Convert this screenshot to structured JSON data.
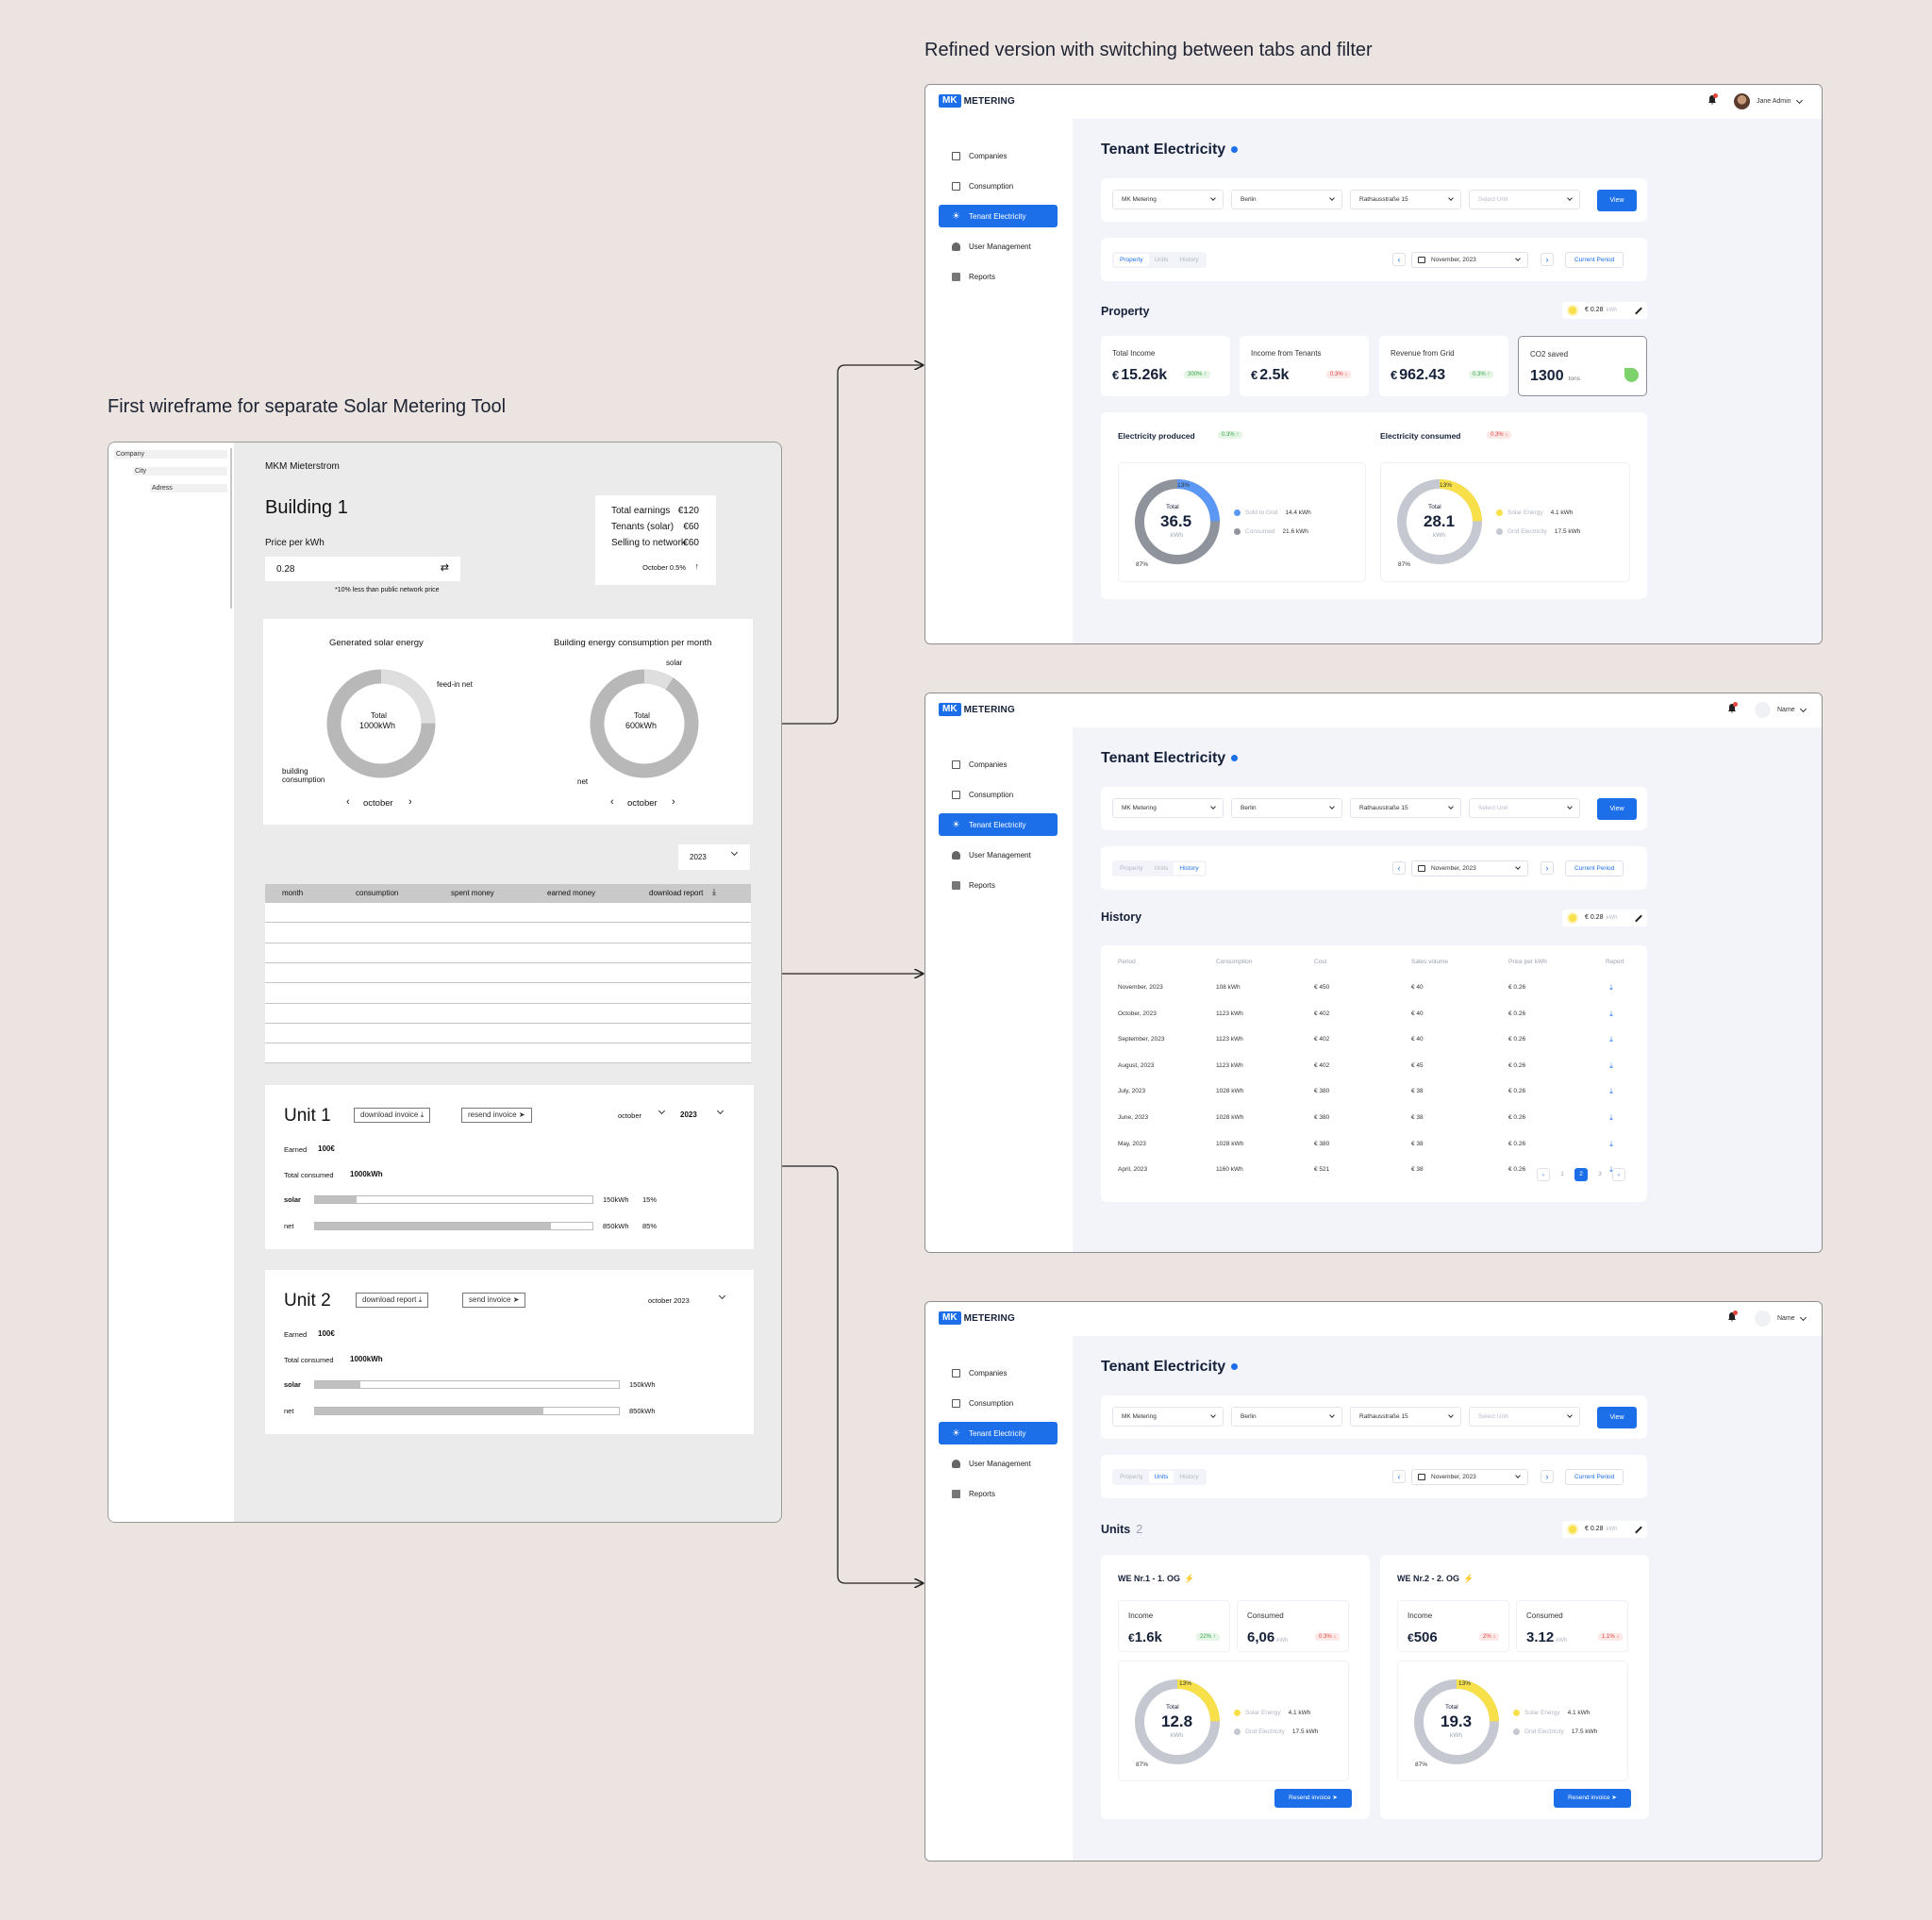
{
  "captions": {
    "refined": "Refined version with  switching between tabs and filter",
    "first": "First wireframe for separate Solar Metering Tool"
  },
  "wireframe": {
    "tree": [
      "Company",
      "City",
      "Adress"
    ],
    "header": "MKM Mieterstrom",
    "building": "Building 1",
    "price_label": "Price per kWh",
    "price_value": "0.28",
    "price_note": "*10% less than public network price",
    "summary": [
      {
        "label": "Total earnings",
        "value": "€120"
      },
      {
        "label": "Tenants (solar)",
        "value": "€60"
      },
      {
        "label": "Selling to network",
        "value": "€60"
      }
    ],
    "summary_foot": "October  0.5%",
    "chart1": {
      "title": "Generated solar energy",
      "total_label": "Total",
      "total": "1000kWh",
      "label_a": "feed-in net",
      "label_b": "building consumption",
      "month": "october"
    },
    "chart2": {
      "title": "Building energy consumption per month",
      "total_label": "Total",
      "total": "600kWh",
      "label_a": "solar",
      "label_b": "net",
      "month": "october"
    },
    "year_select": "2023",
    "table_headers": [
      "month",
      "consumption",
      "spent money",
      "earned money",
      "download report"
    ],
    "unit1": {
      "title": "Unit 1",
      "btn1": "download invoice",
      "btn2": "resend invoice",
      "month": "october",
      "year": "2023",
      "earned_label": "Earned",
      "earned": "100€",
      "total_label": "Total consumed",
      "total": "1000kWh",
      "rows": [
        {
          "name": "solar",
          "value": "150kWh",
          "pct": "15%",
          "fill": 0.15
        },
        {
          "name": "net",
          "value": "850kWh",
          "pct": "85%",
          "fill": 0.85
        }
      ]
    },
    "unit2": {
      "title": "Unit 2",
      "btn1": "download report",
      "btn2": "send invoice",
      "period": "october 2023",
      "earned_label": "Earned",
      "earned": "100€",
      "total_label": "Total consumed",
      "total": "1000kWh",
      "rows": [
        {
          "name": "solar",
          "value": "150kWh",
          "fill": 0.15
        },
        {
          "name": "net",
          "value": "850kWh",
          "fill": 0.75
        }
      ]
    }
  },
  "app": {
    "logo_mk": "MK",
    "logo_text": "METERING",
    "user1": "Jane Admin",
    "user2": "Name",
    "nav": [
      "Companies",
      "Consumption",
      "Tenant Electricity",
      "User Management",
      "Reports"
    ],
    "title": "Tenant Electricity",
    "filters": [
      "MK Metering",
      "Berlin",
      "Rathausstraße 15",
      "Select Unit"
    ],
    "view": "View",
    "tabs": [
      "Property",
      "Units",
      "History"
    ],
    "month": "November, 2023",
    "current": "Current Period",
    "price": "€ 0.28",
    "price_unit": "kWh",
    "colors": {
      "accent": "#1c6fe8",
      "blue": "#5b98f5",
      "gray": "#8f939b",
      "yellow": "#f7e04a",
      "lightgray": "#c5c8d0",
      "green": "#7cd36b"
    }
  },
  "property": {
    "section": "Property",
    "kpis": [
      {
        "label": "Total Income",
        "cur": "€",
        "value": "15.26k",
        "tag": "300% ↑",
        "dir": "up"
      },
      {
        "label": "Income from Tenants",
        "cur": "€",
        "value": "2.5k",
        "tag": "0.3% ↓",
        "dir": "down"
      },
      {
        "label": "Revenue from Grid",
        "cur": "€",
        "value": "962.43",
        "tag": "0.3% ↑",
        "dir": "up"
      },
      {
        "label": "CO2 saved",
        "cur": "",
        "value": "1300",
        "unit": "tons"
      }
    ],
    "produced": {
      "title": "Electricity produced",
      "tag": "0.3% ↑",
      "total_label": "Total",
      "total": "36.5",
      "unit": "kWh",
      "pct_small": "13%",
      "pct_big": "87%",
      "legend": [
        {
          "label": "Sold to Grid",
          "value": "14.4 kWh"
        },
        {
          "label": "Consumed",
          "value": "21.6 kWh"
        }
      ],
      "share": 0.13
    },
    "consumed": {
      "title": "Electricity consumed",
      "tag": "0.3% ↓",
      "total_label": "Total",
      "total": "28.1",
      "unit": "kWh",
      "pct_small": "13%",
      "pct_big": "87%",
      "legend": [
        {
          "label": "Solar Energy",
          "value": "4.1 kWh"
        },
        {
          "label": "Grid Electricity",
          "value": "17.5 kWh"
        }
      ],
      "share": 0.13
    }
  },
  "history": {
    "section": "History",
    "headers": [
      "Period",
      "Consumption",
      "Cost",
      "Sales volume",
      "Price per kWh",
      "Report"
    ],
    "rows": [
      [
        "November, 2023",
        "108 kWh",
        "€ 450",
        "€ 40",
        "€ 0.26"
      ],
      [
        "October, 2023",
        "1123 kWh",
        "€ 402",
        "€ 40",
        "€ 0.26"
      ],
      [
        "September, 2023",
        "1123 kWh",
        "€ 402",
        "€ 40",
        "€ 0.26"
      ],
      [
        "August, 2023",
        "1123 kWh",
        "€ 402",
        "€ 45",
        "€ 0.26"
      ],
      [
        "July, 2023",
        "1028 kWh",
        "€ 380",
        "€ 38",
        "€ 0.26"
      ],
      [
        "June, 2023",
        "1028 kWh",
        "€ 380",
        "€ 38",
        "€ 0.26"
      ],
      [
        "May, 2023",
        "1028 kWh",
        "€ 380",
        "€ 38",
        "€ 0.26"
      ],
      [
        "April, 2023",
        "1160 kWh",
        "€ 521",
        "€ 38",
        "€ 0.26"
      ]
    ],
    "pages": [
      "‹",
      "1",
      "2",
      "3",
      "›"
    ]
  },
  "units": {
    "section": "Units",
    "count": "2",
    "cards": [
      {
        "name": "WE Nr.1 - 1. OG",
        "income_label": "Income",
        "income_cur": "€",
        "income": "1.6k",
        "income_tag": "22% ↑",
        "cons_label": "Consumed",
        "cons": "6,06",
        "cons_unit": "kWh",
        "cons_tag": "0.3% ↓",
        "total_label": "Total",
        "total": "12.8",
        "unit": "kWh",
        "pct_small": "13%",
        "pct_big": "87%",
        "legend": [
          {
            "label": "Solar Energy",
            "value": "4.1 kWh"
          },
          {
            "label": "Grid Electricity",
            "value": "17.5 kWh"
          }
        ],
        "button": "Resend invoice"
      },
      {
        "name": "WE Nr.2 - 2. OG",
        "income_label": "Income",
        "income_cur": "€",
        "income": "506",
        "income_tag": "2% ↓",
        "cons_label": "Consumed",
        "cons": "3.12",
        "cons_unit": "kWh",
        "cons_tag": "1.1% ↓",
        "total_label": "Total",
        "total": "19.3",
        "unit": "kWh",
        "pct_small": "13%",
        "pct_big": "87%",
        "legend": [
          {
            "label": "Solar Energy",
            "value": "4.1 kWh"
          },
          {
            "label": "Grid Electricity",
            "value": "17.5 kWh"
          }
        ],
        "button": "Resend invoice"
      }
    ]
  }
}
